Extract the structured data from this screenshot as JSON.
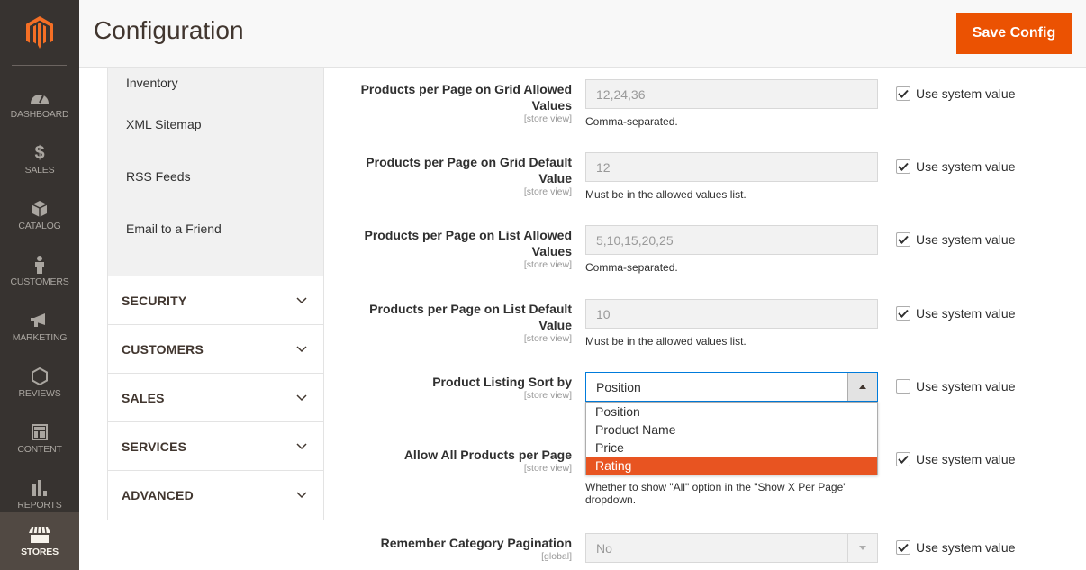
{
  "nav": {
    "items": [
      {
        "label": "DASHBOARD",
        "icon": "dashboard-icon"
      },
      {
        "label": "SALES",
        "icon": "dollar-icon"
      },
      {
        "label": "CATALOG",
        "icon": "box-icon"
      },
      {
        "label": "CUSTOMERS",
        "icon": "person-icon"
      },
      {
        "label": "MARKETING",
        "icon": "megaphone-icon"
      },
      {
        "label": "REVIEWS",
        "icon": "hexagon-icon"
      },
      {
        "label": "CONTENT",
        "icon": "layout-icon"
      },
      {
        "label": "REPORTS",
        "icon": "bar-chart-icon"
      },
      {
        "label": "STORES",
        "icon": "storefront-icon",
        "active": true
      }
    ]
  },
  "header": {
    "title": "Configuration",
    "save_label": "Save Config"
  },
  "colors": {
    "accent": "#eb5202",
    "nav_bg": "#373330",
    "selected_option": "#e85421"
  },
  "tabs": {
    "sub_items": [
      "Inventory",
      "XML Sitemap",
      "RSS Feeds",
      "Email to a Friend"
    ],
    "sections": [
      "SECURITY",
      "CUSTOMERS",
      "SALES",
      "SERVICES",
      "ADVANCED"
    ]
  },
  "fields": [
    {
      "label": "Products per Page on Grid Allowed Values",
      "scope": "[store view]",
      "value": "12,24,36",
      "note": "Comma-separated.",
      "use_system": true,
      "use_system_label": "Use system value"
    },
    {
      "label": "Products per Page on Grid Default Value",
      "scope": "[store view]",
      "value": "12",
      "note": "Must be in the allowed values list.",
      "use_system": true,
      "use_system_label": "Use system value"
    },
    {
      "label": "Products per Page on List Allowed Values",
      "scope": "[store view]",
      "value": "5,10,15,20,25",
      "note": "Comma-separated.",
      "use_system": true,
      "use_system_label": "Use system value"
    },
    {
      "label": "Products per Page on List Default Value",
      "scope": "[store view]",
      "value": "10",
      "note": "Must be in the allowed values list.",
      "use_system": true,
      "use_system_label": "Use system value"
    },
    {
      "label": "Product Listing Sort by",
      "scope": "[store view]",
      "value": "Position",
      "use_system": false,
      "use_system_label": "Use system value",
      "options": [
        "Position",
        "Product Name",
        "Price",
        "Rating"
      ],
      "highlighted_option": "Rating"
    },
    {
      "label": "Allow All Products per Page",
      "scope": "[store view]",
      "note": "Whether to show \"All\" option in the \"Show X Per Page\" dropdown.",
      "use_system": true,
      "use_system_label": "Use system value"
    },
    {
      "label": "Remember Category Pagination",
      "scope": "[global]",
      "value": "No",
      "use_system": true,
      "use_system_label": "Use system value"
    }
  ]
}
